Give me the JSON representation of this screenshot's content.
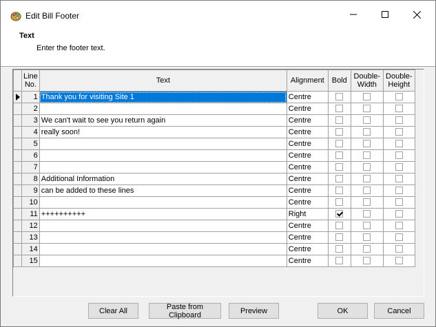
{
  "window": {
    "title": "Edit Bill Footer",
    "controls": {
      "minimize": "–",
      "maximize": "☐",
      "close": "✕"
    }
  },
  "header": {
    "title": "Text",
    "description": "Enter the footer text."
  },
  "grid": {
    "columns": {
      "line_no": [
        "Line",
        "No."
      ],
      "text": "Text",
      "alignment": "Alignment",
      "bold": "Bold",
      "double_width": [
        "Double-",
        "Width"
      ],
      "double_height": [
        "Double-",
        "Height"
      ]
    },
    "current_row": 1,
    "rows": [
      {
        "line": "1",
        "text": "Thank you for visiting Site 1",
        "alignment": "Centre",
        "bold": false,
        "double_width": false,
        "double_height": false
      },
      {
        "line": "2",
        "text": "",
        "alignment": "Centre",
        "bold": false,
        "double_width": false,
        "double_height": false
      },
      {
        "line": "3",
        "text": "We can't wait to see you return again",
        "alignment": "Centre",
        "bold": false,
        "double_width": false,
        "double_height": false
      },
      {
        "line": "4",
        "text": "really soon!",
        "alignment": "Centre",
        "bold": false,
        "double_width": false,
        "double_height": false
      },
      {
        "line": "5",
        "text": "",
        "alignment": "Centre",
        "bold": false,
        "double_width": false,
        "double_height": false
      },
      {
        "line": "6",
        "text": "",
        "alignment": "Centre",
        "bold": false,
        "double_width": false,
        "double_height": false
      },
      {
        "line": "7",
        "text": "",
        "alignment": "Centre",
        "bold": false,
        "double_width": false,
        "double_height": false
      },
      {
        "line": "8",
        "text": "Additional Information",
        "alignment": "Centre",
        "bold": false,
        "double_width": false,
        "double_height": false
      },
      {
        "line": "9",
        "text": "can be added to these lines",
        "alignment": "Centre",
        "bold": false,
        "double_width": false,
        "double_height": false
      },
      {
        "line": "10",
        "text": "",
        "alignment": "Centre",
        "bold": false,
        "double_width": false,
        "double_height": false
      },
      {
        "line": "11",
        "text": "++++++++++",
        "alignment": "Right",
        "bold": true,
        "double_width": false,
        "double_height": false
      },
      {
        "line": "12",
        "text": "",
        "alignment": "Centre",
        "bold": false,
        "double_width": false,
        "double_height": false
      },
      {
        "line": "13",
        "text": "",
        "alignment": "Centre",
        "bold": false,
        "double_width": false,
        "double_height": false
      },
      {
        "line": "14",
        "text": "",
        "alignment": "Centre",
        "bold": false,
        "double_width": false,
        "double_height": false
      },
      {
        "line": "15",
        "text": "",
        "alignment": "Centre",
        "bold": false,
        "double_width": false,
        "double_height": false
      }
    ]
  },
  "buttons": {
    "clear_all": "Clear All",
    "paste": "Paste from Clipboard",
    "preview": "Preview",
    "ok": "OK",
    "cancel": "Cancel"
  },
  "colors": {
    "selection": "#0078d7",
    "window_bg": "#f0f0f0",
    "button_bg": "#e1e1e1"
  }
}
